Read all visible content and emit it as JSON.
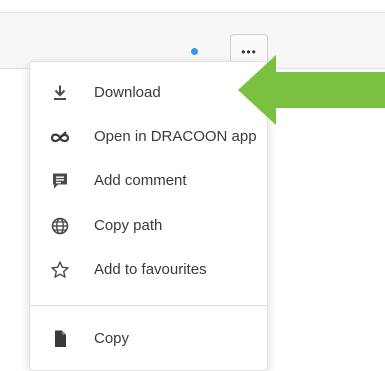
{
  "toolbar": {
    "more_label": "•••",
    "status_color": "#3a97e6"
  },
  "menu": {
    "items": [
      {
        "label": "Download",
        "icon": "download-icon"
      },
      {
        "label": "Open in DRACOON app",
        "icon": "dracoon-logo-icon"
      },
      {
        "label": "Add comment",
        "icon": "comment-icon"
      },
      {
        "label": "Copy path",
        "icon": "globe-icon"
      },
      {
        "label": "Add to favourites",
        "icon": "star-outline-icon"
      },
      {
        "label": "Copy",
        "icon": "file-copy-icon"
      }
    ]
  },
  "annotation": {
    "arrow_color": "#7ac142",
    "arrow_target": "Download"
  }
}
